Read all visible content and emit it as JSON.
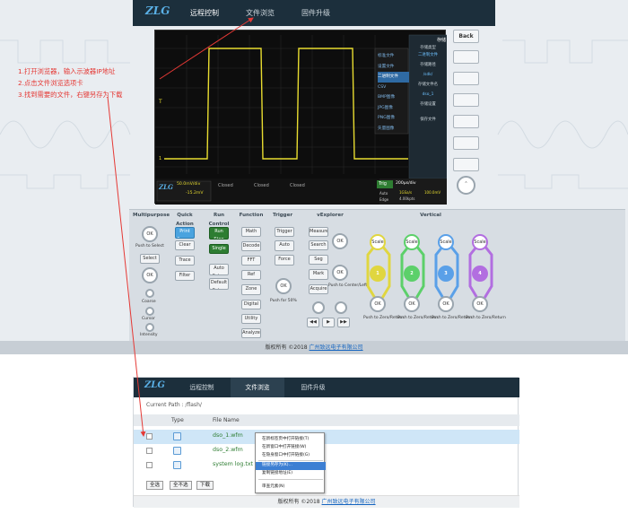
{
  "top_window": {
    "nav": {
      "remote": "远程控制",
      "browse": "文件浏览",
      "upgrade": "固件升级"
    },
    "back_label": "Back",
    "scope": {
      "right_menu_header": "存储",
      "save_menu": [
        "标准文件",
        "设置文件",
        "二进制文件",
        "CSV",
        "BMP图像",
        "JPG图像",
        "PNG图像",
        "矢量图像"
      ],
      "right_menu": [
        "存储类型",
        "二进制文件",
        "存储路径",
        "/sdk/",
        "存储文件名",
        "dso_1",
        "存储设置",
        "保存文件"
      ],
      "ch_scale": "50.0mV/div",
      "ch_offset": "-15.2mV",
      "closed_label": "Closed",
      "trig_label": "Trig",
      "time_scale": "200μs/div",
      "trig_mode": "Auto",
      "trig_sub": "Edge",
      "sample_rate": "1GSa/s",
      "points": "4.00kpts",
      "small_val": "100.0mV",
      "cursor_t": "T",
      "cursor_1": "1"
    },
    "controls": {
      "headers": [
        "Multipurpose",
        "Quick Action",
        "Run Control",
        "Function",
        "Trigger",
        "vExplorer",
        "Vertical"
      ],
      "ok": "OK",
      "push_select": "Push to Select",
      "select": "Select",
      "coarse": "Coarse",
      "intensity": "Intensity",
      "cursor": "Cursor",
      "print_screen": "Print Screen",
      "clear": "Clear",
      "trace": "Trace",
      "filter": "Filter",
      "run_stop": "Run Stop",
      "single": "Single",
      "auto_setup": "Auto Setup",
      "default_setup": "Default Setup",
      "functions": [
        "Math",
        "Decode",
        "FFT",
        "Ref",
        "Zone Recall",
        "Digital",
        "Utility",
        "Analyze"
      ],
      "trigger_btns": [
        "Trigger",
        "Auto Normal",
        "Force Trig"
      ],
      "push_trig": "Push for 50%",
      "vexplorer_btns": [
        "Measure",
        "Search",
        "Seg",
        "Mark Clear",
        "Acquire"
      ],
      "push_center": "Push to Center/Left",
      "scale": "Scale",
      "channels": [
        "1",
        "2",
        "3",
        "4"
      ],
      "push_zero": "Push to Zero/Return",
      "vertical_pos": "Position"
    },
    "footer_text": "版权所有 ©2018",
    "footer_link": "广州致远电子有限公司"
  },
  "annotations": {
    "step1": "1.打开浏览器，输入示波器IP地址",
    "step2": "2.点击文件浏览选项卡",
    "step3": "3.找到需要的文件，右键另存为下载"
  },
  "bottom_window": {
    "nav": {
      "remote": "远程控制",
      "browse": "文件浏览",
      "upgrade": "固件升级"
    },
    "current_path": "Current Path : /flash/",
    "col_type": "Type",
    "col_name": "File Name",
    "files": [
      "dso_1.wfm",
      "dso_2.wfm",
      "system log.txt"
    ],
    "btn_select_all": "全选",
    "btn_deselect": "全不选",
    "btn_download": "下载",
    "context_menu": [
      "在新标签页中打开链接(T)",
      "在新窗口中打开链接(W)",
      "在隐身窗口中打开链接(G)",
      "链接另存为(K)...",
      "复制链接地址(E)",
      "审查元素(N)"
    ],
    "footer_text": "版权所有 ©2018",
    "footer_link": "广州致远电子有限公司"
  },
  "colors": {
    "nav": "#1c2f3c",
    "accent": "#e53935",
    "link": "#1565c0",
    "ch1": "#e0d640",
    "ch2": "#5cd06a",
    "ch3": "#5aa0e8",
    "ch4": "#b26ee0"
  }
}
